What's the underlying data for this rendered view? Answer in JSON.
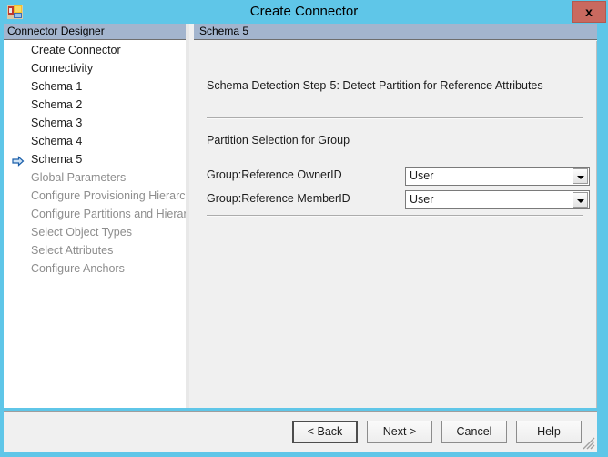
{
  "window": {
    "title": "Create Connector",
    "app_icon": "connector-app-icon",
    "close_label": "x",
    "titlebar_color": "#5FC6E8",
    "close_button_color": "#C9695F"
  },
  "left_panel": {
    "header": "Connector Designer",
    "items": [
      {
        "label": "Create Connector",
        "state": "enabled",
        "current": false
      },
      {
        "label": "Connectivity",
        "state": "enabled",
        "current": false
      },
      {
        "label": "Schema 1",
        "state": "enabled",
        "current": false
      },
      {
        "label": "Schema 2",
        "state": "enabled",
        "current": false
      },
      {
        "label": "Schema 3",
        "state": "enabled",
        "current": false
      },
      {
        "label": "Schema 4",
        "state": "enabled",
        "current": false
      },
      {
        "label": "Schema 5",
        "state": "enabled",
        "current": true
      },
      {
        "label": "Global Parameters",
        "state": "disabled",
        "current": false
      },
      {
        "label": "Configure Provisioning Hierarchy",
        "state": "disabled",
        "current": false
      },
      {
        "label": "Configure Partitions and Hierarchies",
        "state": "disabled",
        "current": false
      },
      {
        "label": "Select Object Types",
        "state": "disabled",
        "current": false
      },
      {
        "label": "Select Attributes",
        "state": "disabled",
        "current": false
      },
      {
        "label": "Configure Anchors",
        "state": "disabled",
        "current": false
      }
    ]
  },
  "right_panel": {
    "header": "Schema 5",
    "step_title": "Schema Detection Step-5: Detect Partition for Reference Attributes",
    "section_title": "Partition Selection for Group",
    "fields": [
      {
        "label": "Group:Reference OwnerID",
        "value": "User"
      },
      {
        "label": "Group:Reference MemberID",
        "value": "User"
      }
    ]
  },
  "buttons": {
    "back": "< Back",
    "next": "Next  >",
    "cancel": "Cancel",
    "help": "Help"
  }
}
